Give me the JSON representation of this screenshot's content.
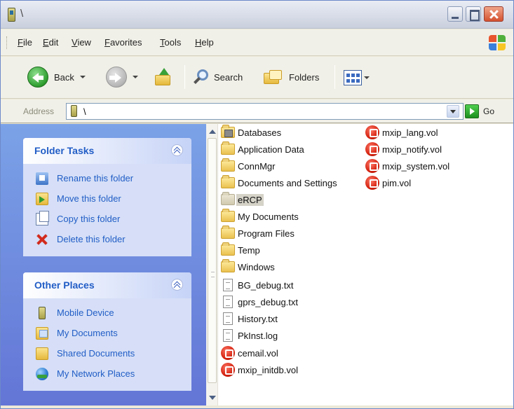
{
  "window": {
    "title": "\\",
    "colors": {
      "titlebar": "#d6dbe7",
      "taskpane_bg": "#6f8fde",
      "link": "#215dc6"
    }
  },
  "menu": {
    "items": [
      {
        "label": "File"
      },
      {
        "label": "Edit"
      },
      {
        "label": "View"
      },
      {
        "label": "Favorites"
      },
      {
        "label": "Tools"
      },
      {
        "label": "Help"
      }
    ]
  },
  "toolbar": {
    "back_label": "Back",
    "search_label": "Search",
    "folders_label": "Folders",
    "icons": [
      "back-arrow-icon",
      "forward-arrow-icon",
      "folder-up-icon",
      "search-icon",
      "folders-icon",
      "views-icon"
    ]
  },
  "address": {
    "label": "Address",
    "value": "\\",
    "go_label": "Go"
  },
  "folder_tasks": {
    "title": "Folder Tasks",
    "items": [
      {
        "label": "Rename this folder",
        "icon": "rename-icon"
      },
      {
        "label": "Move this folder",
        "icon": "move-icon"
      },
      {
        "label": "Copy this folder",
        "icon": "copy-icon"
      },
      {
        "label": "Delete this folder",
        "icon": "delete-icon"
      }
    ]
  },
  "other_places": {
    "title": "Other Places",
    "items": [
      {
        "label": "Mobile Device",
        "icon": "mobile-device-icon"
      },
      {
        "label": "My Documents",
        "icon": "my-documents-icon"
      },
      {
        "label": "Shared Documents",
        "icon": "shared-documents-icon"
      },
      {
        "label": "My Network Places",
        "icon": "network-places-icon"
      }
    ]
  },
  "files": {
    "column1": [
      {
        "name": "Databases",
        "type": "database-folder"
      },
      {
        "name": "Application Data",
        "type": "folder"
      },
      {
        "name": "ConnMgr",
        "type": "folder"
      },
      {
        "name": "Documents and Settings",
        "type": "folder"
      },
      {
        "name": "eRCP",
        "type": "folder",
        "selected": true
      },
      {
        "name": "My Documents",
        "type": "folder"
      },
      {
        "name": "Program Files",
        "type": "folder"
      },
      {
        "name": "Temp",
        "type": "folder"
      },
      {
        "name": "Windows",
        "type": "folder"
      },
      {
        "name": "BG_debug.txt",
        "type": "text-file"
      },
      {
        "name": "gprs_debug.txt",
        "type": "text-file"
      },
      {
        "name": "History.txt",
        "type": "text-file"
      },
      {
        "name": "PkInst.log",
        "type": "text-file"
      },
      {
        "name": "cemail.vol",
        "type": "vol-file"
      },
      {
        "name": "mxip_initdb.vol",
        "type": "vol-file"
      }
    ],
    "column2": [
      {
        "name": "mxip_lang.vol",
        "type": "vol-file"
      },
      {
        "name": "mxip_notify.vol",
        "type": "vol-file"
      },
      {
        "name": "mxip_system.vol",
        "type": "vol-file"
      },
      {
        "name": "pim.vol",
        "type": "vol-file"
      }
    ]
  }
}
